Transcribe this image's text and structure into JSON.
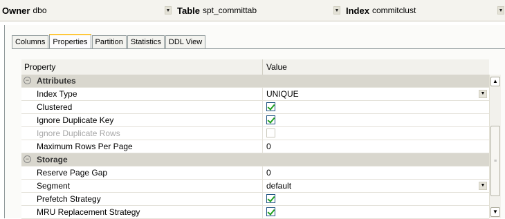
{
  "selectors": {
    "owner": {
      "label": "Owner",
      "value": "dbo"
    },
    "table": {
      "label": "Table",
      "value": "spt_committab"
    },
    "index": {
      "label": "Index",
      "value": "commitclust"
    }
  },
  "tabs": [
    "Columns",
    "Properties",
    "Partition",
    "Statistics",
    "DDL View"
  ],
  "active_tab": "Properties",
  "grid": {
    "header": {
      "property": "Property",
      "value": "Value"
    },
    "categories": {
      "attributes": "Attributes",
      "storage": "Storage"
    },
    "rows": {
      "index_type": {
        "name": "Index Type",
        "value": "UNIQUE"
      },
      "clustered": {
        "name": "Clustered",
        "checked": true
      },
      "ignore_dup_key": {
        "name": "Ignore Duplicate Key",
        "checked": true
      },
      "ignore_dup_rows": {
        "name": "Ignore Duplicate Rows",
        "checked": false,
        "disabled": true
      },
      "max_rows_per_page": {
        "name": "Maximum Rows Per Page",
        "value": "0"
      },
      "reserve_page_gap": {
        "name": "Reserve Page Gap",
        "value": "0"
      },
      "segment": {
        "name": "Segment",
        "value": "default"
      },
      "prefetch_strategy": {
        "name": "Prefetch Strategy",
        "checked": true
      },
      "mru_replacement": {
        "name": "MRU Replacement Strategy",
        "checked": true
      }
    }
  },
  "colors": {
    "tab_highlight": "#ffc83c",
    "category_bg": "#d9d7ce",
    "check_green": "#21a121"
  }
}
